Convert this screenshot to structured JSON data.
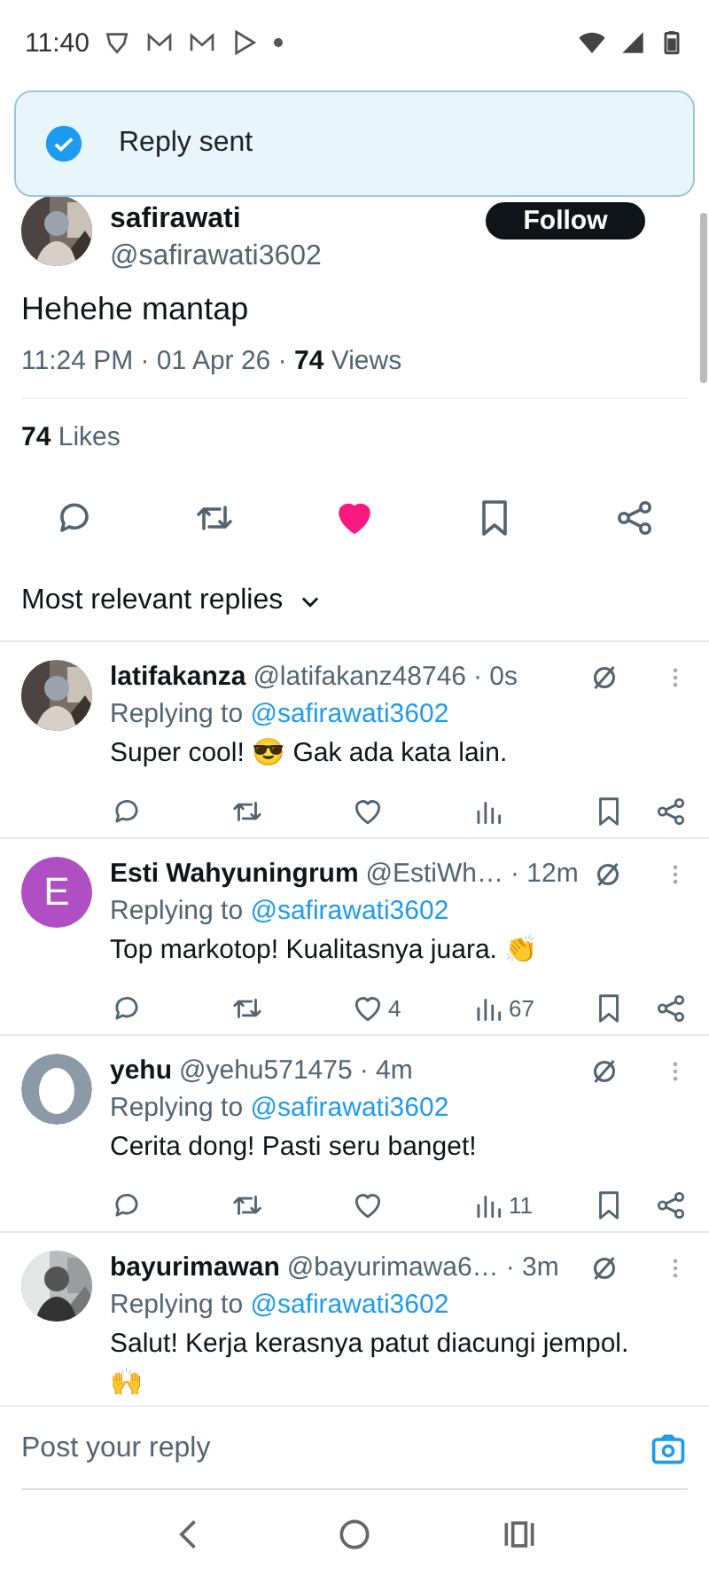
{
  "status_bar": {
    "time": "11:40"
  },
  "toast": {
    "text": "Reply sent"
  },
  "post": {
    "name": "safirawati",
    "handle": "@safirawati3602",
    "follow_label": "Follow",
    "text": "Hehehe mantap",
    "time": "11:24 PM · 01 Apr 26 · ",
    "views_count": "74",
    "views_label": " Views",
    "likes_count": "74",
    "likes_label": " Likes",
    "liked": true
  },
  "replies_sort": {
    "label": "Most relevant replies"
  },
  "replies": [
    {
      "name": "latifakanza",
      "handle": "@latifakanz48746",
      "time": "· 0s",
      "replying_label": "Replying to ",
      "replying_to": "@safirawati3602",
      "text": "Super cool! 😎 Gak ada kata lain.",
      "liked": false
    },
    {
      "avatar": {
        "kind": "letter",
        "letter": "E",
        "color": "#b04fc4"
      },
      "name": "Esti Wahyuningrum",
      "handle": "@EstiWh…",
      "time": "· 12m",
      "replying_label": "Replying to ",
      "replying_to": "@safirawati3602",
      "text": "Top markotop! Kualitasnya juara. 👏",
      "liked": false,
      "likes": "4",
      "views": "67"
    },
    {
      "avatar": {
        "kind": "default"
      },
      "name": "yehu",
      "handle": "@yehu571475",
      "time": "· 4m",
      "replying_label": "Replying to ",
      "replying_to": "@safirawati3602",
      "text": "Cerita dong! Pasti seru banget!",
      "liked": false,
      "views": "11"
    },
    {
      "name": "bayurimawan",
      "handle": "@bayurimawa6…",
      "time": "· 3m",
      "replying_label": "Replying to ",
      "replying_to": "@safirawati3602",
      "text": "Salut! Kerja kerasnya patut diacungi jempol. 🙌"
    }
  ],
  "reply_field": {
    "placeholder": "Post your reply"
  }
}
